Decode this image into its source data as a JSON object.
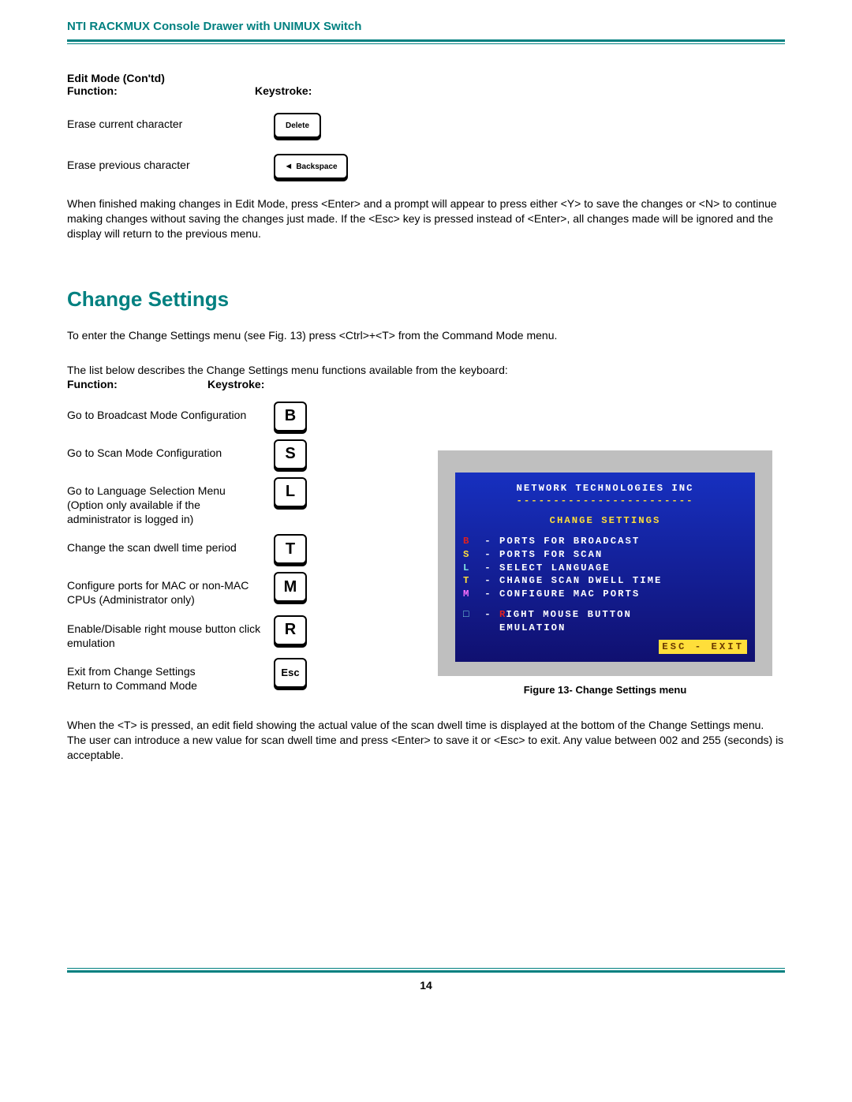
{
  "header": {
    "title": "NTI RACKMUX Console Drawer with UNIMUX Switch"
  },
  "edit_mode": {
    "title": "Edit Mode (Con'td)",
    "func_header": "Function:",
    "key_header": "Keystroke:",
    "rows": [
      {
        "label": "Erase current character",
        "key": "Delete"
      },
      {
        "label": "Erase previous character",
        "key": "Backspace"
      }
    ],
    "paragraph": "When finished making changes in Edit Mode, press <Enter> and a prompt will appear to press either <Y> to save the changes or <N> to continue making changes without saving the changes just made.    If the <Esc> key is pressed instead of <Enter>, all changes made will be ignored and the display will return to the previous menu."
  },
  "change_settings": {
    "heading": "Change Settings",
    "intro": "To enter the Change Settings menu (see Fig. 13) press <Ctrl>+<T> from the Command Mode menu.",
    "list_intro": "The list below describes the Change Settings menu functions available from the keyboard:",
    "func_header": "Function:",
    "key_header": "Keystroke:",
    "rows": [
      {
        "label": "Go to Broadcast Mode Configuration",
        "sub": "",
        "key": "B"
      },
      {
        "label": "Go to Scan Mode Configuration",
        "sub": "",
        "key": "S"
      },
      {
        "label": "Go to Language Selection Menu",
        "sub": "(Option only available if the\n administrator is logged in)",
        "key": "L"
      },
      {
        "label": "Change the scan dwell time period",
        "sub": "",
        "key": "T"
      },
      {
        "label": "Configure ports for MAC or non-MAC CPUs (Administrator only)",
        "sub": "",
        "key": "M"
      },
      {
        "label": "Enable/Disable right mouse button click emulation",
        "sub": "",
        "key": "R"
      },
      {
        "label": "Exit from Change Settings\nReturn to Command Mode",
        "sub": "",
        "key": "Esc"
      }
    ],
    "outro": "When the <T> is pressed, an edit field showing the actual value of the scan dwell time is displayed at the bottom of the Change Settings menu. The user can introduce a new value for scan dwell time and press <Enter> to save it or <Esc> to exit. Any value between 002 and 255 (seconds) is acceptable."
  },
  "osd": {
    "title1": "NETWORK TECHNOLOGIES INC",
    "divider": "------------------------",
    "title2": "CHANGE SETTINGS",
    "items": [
      {
        "key": "B",
        "text": "PORTS FOR BROADCAST",
        "color": "red"
      },
      {
        "key": "S",
        "text": "PORTS FOR SCAN",
        "color": "yellow"
      },
      {
        "key": "L",
        "text": "SELECT LANGUAGE",
        "color": "cyan"
      },
      {
        "key": "T",
        "text": "CHANGE SCAN DWELL TIME",
        "color": "yellow"
      },
      {
        "key": "M",
        "text": "CONFIGURE MAC PORTS",
        "color": "pink"
      }
    ],
    "rb_key": "□",
    "rb_text1": "RIGHT MOUSE BUTTON",
    "rb_text2": "EMULATION",
    "exit": "ESC - EXIT"
  },
  "figure_caption": "Figure 13- Change Settings menu",
  "page_number": "14"
}
